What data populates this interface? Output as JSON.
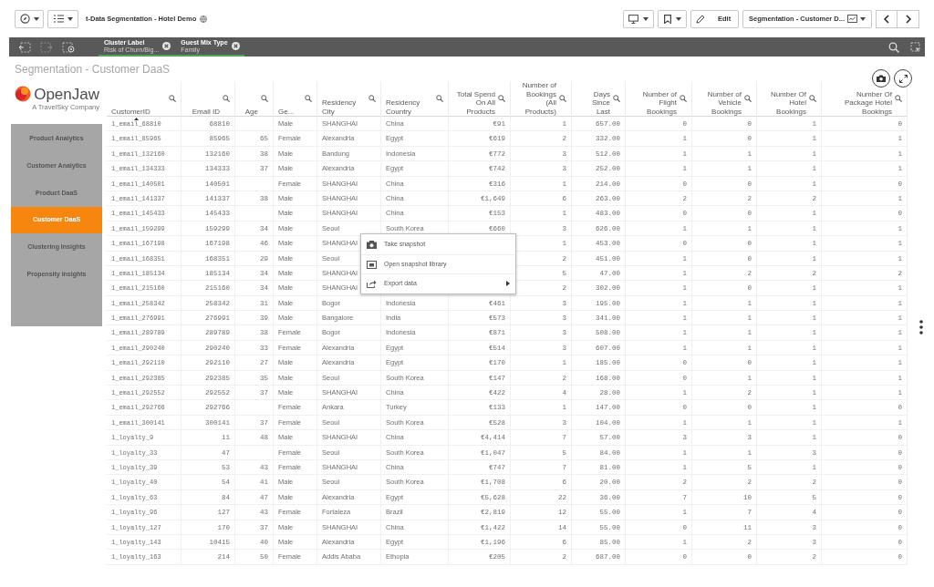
{
  "toolbar": {
    "app_title": "t-Data Segmentation - Hotel Demo",
    "edit_label": "Edit",
    "sheet_name": "Segmentation - Customer D..."
  },
  "selections": [
    {
      "field": "Cluster Label",
      "value": "Risk of Churn/Big..."
    },
    {
      "field": "Guest Mix Type",
      "value": "Family"
    }
  ],
  "sheet_title": "Segmentation - Customer DaaS",
  "logo": {
    "name": "OpenJaw",
    "tagline": "A TravelSky Company"
  },
  "nav": [
    {
      "label": "Product Analytics",
      "selected": false
    },
    {
      "label": "Customer Analytics",
      "selected": false
    },
    {
      "label": "Product DaaS",
      "selected": false
    },
    {
      "label": "Customer DaaS",
      "selected": true
    },
    {
      "label": "Clustering Insights",
      "selected": false
    },
    {
      "label": "Propensity Insights",
      "selected": false
    }
  ],
  "table": {
    "columns": [
      {
        "label": "CustomerID",
        "kind": "id",
        "sorted": true
      },
      {
        "label": "Email ID",
        "kind": "number",
        "sorted": false
      },
      {
        "label": "Age",
        "kind": "number",
        "sorted": false
      },
      {
        "label": "Ge...",
        "kind": "text",
        "sorted": false
      },
      {
        "label": "Residency City",
        "kind": "text",
        "sorted": false
      },
      {
        "label": "Residency Country",
        "kind": "text",
        "sorted": false
      },
      {
        "label": "Total Spend On All Products",
        "kind": "number",
        "sorted": false
      },
      {
        "label": "Number of Bookings (All Products)",
        "kind": "number",
        "sorted": false
      },
      {
        "label": "Days Since Last",
        "kind": "number",
        "sorted": false
      },
      {
        "label": "Number of Flight Bookings",
        "kind": "number",
        "sorted": false
      },
      {
        "label": "Number of Vehicle Bookings",
        "kind": "number",
        "sorted": false
      },
      {
        "label": "Number Of Hotel Bookings",
        "kind": "number",
        "sorted": false
      },
      {
        "label": "Number Of Package Hotel Bookings",
        "kind": "number",
        "sorted": false
      }
    ],
    "rows": [
      [
        "1_email_68810",
        "68810",
        null,
        "Male",
        "SHANGHAI",
        "China",
        "€91",
        "1",
        "657.00",
        "0",
        "0",
        "1",
        "0"
      ],
      [
        "1_email_85965",
        "85965",
        "65",
        "Female",
        "Alexandria",
        "Egypt",
        "€619",
        "2",
        "332.00",
        "1",
        "0",
        "1",
        "1"
      ],
      [
        "1_email_132160",
        "132160",
        "38",
        "Male",
        "Bandung",
        "Indonesia",
        "€772",
        "3",
        "512.00",
        "1",
        "1",
        "1",
        "1"
      ],
      [
        "1_email_134333",
        "134333",
        "37",
        "Male",
        "Alexandria",
        "Egypt",
        "€742",
        "3",
        "252.00",
        "1",
        "1",
        "1",
        "1"
      ],
      [
        "1_email_140501",
        "140501",
        null,
        "Female",
        "SHANGHAI",
        "China",
        "€316",
        "1",
        "214.00",
        "0",
        "0",
        "1",
        "0"
      ],
      [
        "1_email_141337",
        "141337",
        "38",
        "Male",
        "SHANGHAI",
        "China",
        "€1,649",
        "6",
        "263.00",
        "2",
        "2",
        "2",
        "1"
      ],
      [
        "1_email_145433",
        "145433",
        null,
        "Male",
        "SHANGHAI",
        "China",
        "€153",
        "1",
        "483.00",
        "0",
        "0",
        "1",
        "0"
      ],
      [
        "1_email_159299",
        "159299",
        "34",
        "Male",
        "Seoul",
        "South Korea",
        "€660",
        "3",
        "626.00",
        "1",
        "1",
        "1",
        "1"
      ],
      [
        "1_email_167198",
        "167198",
        "46",
        "Male",
        "SHANGHAI",
        null,
        null,
        "1",
        "453.00",
        "0",
        "0",
        "1",
        "1"
      ],
      [
        "1_email_168351",
        "168351",
        "29",
        "Male",
        "Seoul",
        null,
        null,
        "2",
        "451.00",
        "1",
        "0",
        "1",
        "1"
      ],
      [
        "1_email_185134",
        "185134",
        "34",
        "Male",
        "SHANGHAI",
        null,
        null,
        "5",
        "47.00",
        "1",
        "2",
        "2",
        "2"
      ],
      [
        "1_email_215160",
        "215160",
        "34",
        "Male",
        "SHANGHAI",
        null,
        null,
        "2",
        "302.00",
        "1",
        "0",
        "1",
        "1"
      ],
      [
        "1_email_258342",
        "258342",
        "31",
        "Male",
        "Bogor",
        "Indonesia",
        "€461",
        "3",
        "195.00",
        "1",
        "1",
        "1",
        "1"
      ],
      [
        "1_email_276991",
        "276991",
        "39",
        "Male",
        "Bangalore",
        "India",
        "€573",
        "3",
        "341.00",
        "1",
        "1",
        "1",
        "1"
      ],
      [
        "1_email_289789",
        "289789",
        "38",
        "Female",
        "Bogor",
        "Indonesia",
        "€871",
        "3",
        "508.00",
        "1",
        "1",
        "1",
        "1"
      ],
      [
        "1_email_290240",
        "290240",
        "33",
        "Female",
        "Alexandria",
        "Egypt",
        "€514",
        "3",
        "607.00",
        "1",
        "1",
        "1",
        "1"
      ],
      [
        "1_email_292110",
        "292110",
        "27",
        "Male",
        "Alexandria",
        "Egypt",
        "€170",
        "1",
        "185.00",
        "0",
        "0",
        "1",
        "1"
      ],
      [
        "1_email_292385",
        "292385",
        "35",
        "Male",
        "Seoul",
        "South Korea",
        "€147",
        "2",
        "168.00",
        "0",
        "1",
        "1",
        "1"
      ],
      [
        "1_email_292552",
        "292552",
        "37",
        "Male",
        "SHANGHAI",
        "China",
        "€422",
        "4",
        "28.00",
        "1",
        "2",
        "1",
        "1"
      ],
      [
        "1_email_292766",
        "292766",
        null,
        "Female",
        "Ankara",
        "Turkey",
        "€133",
        "1",
        "147.00",
        "0",
        "0",
        "1",
        "0"
      ],
      [
        "1_email_300141",
        "300141",
        "37",
        "Female",
        "Seoul",
        "South Korea",
        "€528",
        "3",
        "104.00",
        "1",
        "1",
        "1",
        "1"
      ],
      [
        "1_loyalty_9",
        "11",
        "48",
        "Male",
        "SHANGHAI",
        "China",
        "€4,414",
        "7",
        "57.00",
        "3",
        "3",
        "1",
        "0"
      ],
      [
        "1_loyalty_33",
        "47",
        null,
        "Female",
        "Seoul",
        "South Korea",
        "€1,047",
        "5",
        "84.00",
        "1",
        "1",
        "3",
        "0"
      ],
      [
        "1_loyalty_39",
        "53",
        "43",
        "Female",
        "SHANGHAI",
        "China",
        "€747",
        "7",
        "81.00",
        "1",
        "5",
        "1",
        "0"
      ],
      [
        "1_loyalty_40",
        "54",
        "41",
        "Male",
        "Seoul",
        "South Korea",
        "€1,708",
        "6",
        "20.00",
        "2",
        "2",
        "2",
        "0"
      ],
      [
        "1_loyalty_63",
        "84",
        "47",
        "Male",
        "Alexandria",
        "Egypt",
        "€5,628",
        "22",
        "36.00",
        "7",
        "10",
        "5",
        "0"
      ],
      [
        "1_loyalty_96",
        "127",
        "43",
        "Female",
        "Fortaleza",
        "Brazil",
        "€2,819",
        "12",
        "55.00",
        "1",
        "7",
        "4",
        "0"
      ],
      [
        "1_loyalty_127",
        "170",
        "37",
        "Male",
        "SHANGHAI",
        "China",
        "€1,422",
        "14",
        "55.00",
        "0",
        "11",
        "3",
        "0"
      ],
      [
        "1_loyalty_143",
        "10415",
        "40",
        "Male",
        "Alexandria",
        "Egypt",
        "€1,196",
        "6",
        "85.00",
        "1",
        "2",
        "3",
        "0"
      ],
      [
        "1_loyalty_163",
        "214",
        "50",
        "Female",
        "Addis Ababa",
        "Ethopia",
        "€205",
        "2",
        "687.00",
        "0",
        "0",
        "2",
        "0"
      ]
    ]
  },
  "context_menu": [
    {
      "label": "Take snapshot",
      "submenu": false
    },
    {
      "label": "Open snapshot library",
      "submenu": false
    },
    {
      "label": "Export data",
      "submenu": true
    }
  ]
}
